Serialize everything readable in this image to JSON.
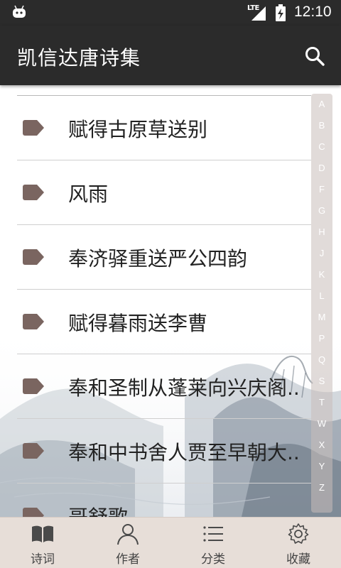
{
  "status_bar": {
    "network": "LTE",
    "time": "12:10",
    "icons": [
      "android-icon",
      "signal-icon",
      "battery-charging-icon"
    ]
  },
  "app_bar": {
    "title": "凯信达唐诗集",
    "search_icon": "search-icon"
  },
  "poems": [
    {
      "title": "赋得古原草送别"
    },
    {
      "title": "风雨"
    },
    {
      "title": "奉济驿重送严公四韵"
    },
    {
      "title": "赋得暮雨送李曹"
    },
    {
      "title": "奉和圣制从蓬莱向兴庆阁.."
    },
    {
      "title": "奉和中书舍人贾至早朝大.."
    },
    {
      "title": "哥舒歌"
    }
  ],
  "index_letters": [
    "A",
    "B",
    "C",
    "D",
    "F",
    "G",
    "H",
    "J",
    "K",
    "L",
    "M",
    "P",
    "Q",
    "S",
    "T",
    "W",
    "X",
    "Y",
    "Z"
  ],
  "bottom_nav": [
    {
      "label": "诗词",
      "icon": "book-icon"
    },
    {
      "label": "作者",
      "icon": "person-icon"
    },
    {
      "label": "分类",
      "icon": "list-icon"
    },
    {
      "label": "收藏",
      "icon": "gear-icon"
    }
  ],
  "colors": {
    "app_bar": "#2b2b2b",
    "tag": "#7a6560",
    "bottom_nav": "#e7ded8",
    "index_bar": "#c8beba"
  }
}
